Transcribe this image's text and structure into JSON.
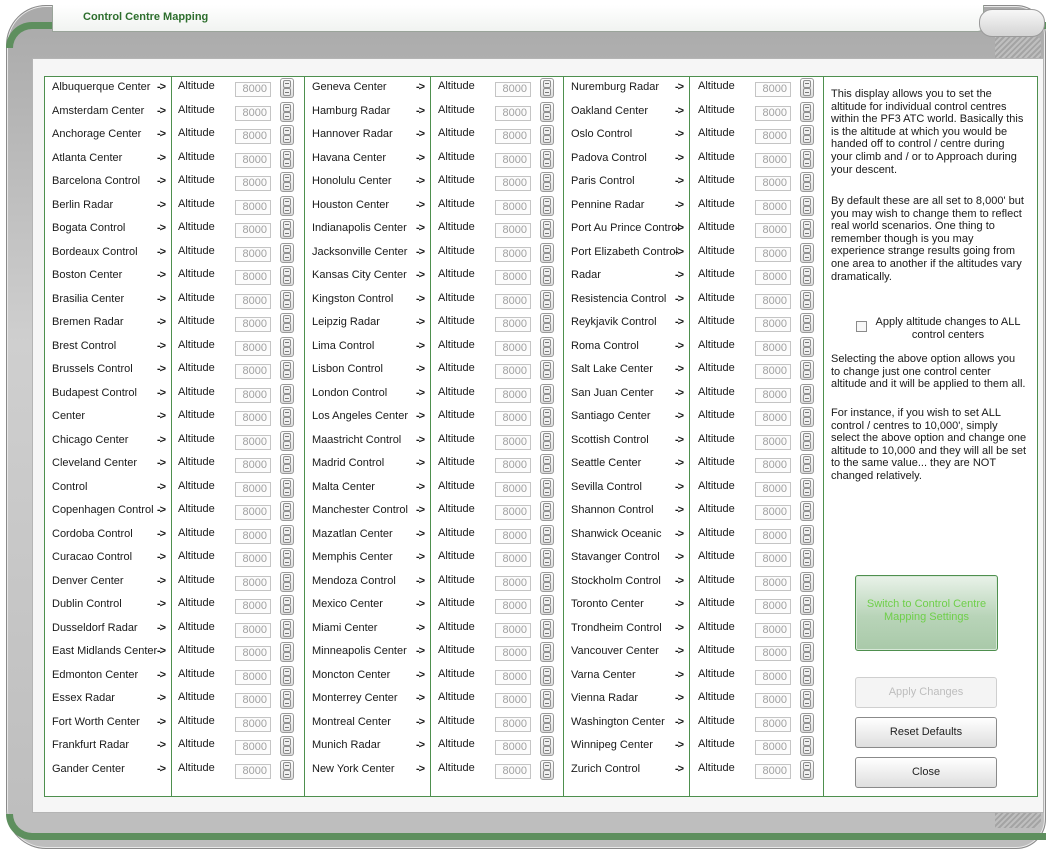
{
  "window": {
    "title": "Control Centre Mapping"
  },
  "column_1": [
    "Albuquerque Center",
    "Amsterdam Center",
    "Anchorage Center",
    "Atlanta Center",
    "Barcelona Control",
    "Berlin Radar",
    "Bogata Control",
    "Bordeaux Control",
    "Boston Center",
    "Brasilia Center",
    "Bremen Radar",
    "Brest Control",
    "Brussels Control",
    "Budapest Control",
    "Center",
    "Chicago Center",
    "Cleveland Center",
    "Control",
    "Copenhagen Control",
    "Cordoba Control",
    "Curacao Control",
    "Denver Center",
    "Dublin Control",
    "Dusseldorf Radar",
    "East Midlands Center",
    "Edmonton Center",
    "Essex Radar",
    "Fort Worth Center",
    "Frankfurt Radar",
    "Gander Center"
  ],
  "column_2": [
    "Geneva Center",
    "Hamburg Radar",
    "Hannover Radar",
    "Havana Center",
    "Honolulu Center",
    "Houston Center",
    "Indianapolis Center",
    "Jacksonville Center",
    "Kansas City Center",
    "Kingston Control",
    "Leipzig Radar",
    "Lima Control",
    "Lisbon Control",
    "London Control",
    "Los Angeles Center",
    "Maastricht Control",
    "Madrid Control",
    "Malta Center",
    "Manchester Control",
    "Mazatlan Center",
    "Memphis Center",
    "Mendoza Control",
    "Mexico Center",
    "Miami Center",
    "Minneapolis Center",
    "Moncton Center",
    "Monterrey Center",
    "Montreal Center",
    "Munich Radar",
    "New York Center"
  ],
  "column_3": [
    "Nuremburg Radar",
    "Oakland Center",
    "Oslo Control",
    "Padova Control",
    "Paris Control",
    "Pennine Radar",
    "Port Au Prince Control",
    "Port Elizabeth Control",
    "Radar",
    "Resistencia Control",
    "Reykjavik Control",
    "Roma Control",
    "Salt Lake Center",
    "San Juan Center",
    "Santiago Center",
    "Scottish Control",
    "Seattle Center",
    "Sevilla Control",
    "Shannon Control",
    "Shanwick Oceanic",
    "Stavanger Control",
    "Stockholm Control",
    "Toronto Center",
    "Trondheim Control",
    "Vancouver Center",
    "Varna Center",
    "Vienna Radar",
    "Washington Center",
    "Winnipeg Center",
    "Zurich Control"
  ],
  "row_common": {
    "arrow": "->",
    "altitude_label": "Altitude",
    "altitude_value": "8000"
  },
  "info": {
    "paragraph_1": "This display allows you to set the altitude for individual control centres within the PF3 ATC world. Basically this is the altitude at which you would be handed off to control / centre during your climb and / or to Approach during your descent.",
    "paragraph_2": "By default these are all set to 8,000' but you may wish to change them to reflect real world scenarios. One thing to remember though is you may experience strange results going from one area to another if the altitudes vary dramatically.",
    "checkbox_label": "Apply altitude changes to ALL control centers",
    "checkbox_checked": false,
    "paragraph_3": "Selecting the above option allows you to change just one control center altitude and it will be applied to them all.",
    "paragraph_4": "For instance, if you wish to set ALL control / centres to 10,000', simply select the above option and change one altitude to 10,000 and they will all be set to the same value... they are NOT changed relatively."
  },
  "buttons": {
    "switch": "Switch to Control Centre Mapping Settings",
    "apply": "Apply Changes",
    "reset": "Reset Defaults",
    "close": "Close"
  },
  "colors": {
    "accent_green": "#4e8f4e",
    "title_green": "#2d6e2d",
    "switch_text": "#6fcf4a"
  }
}
